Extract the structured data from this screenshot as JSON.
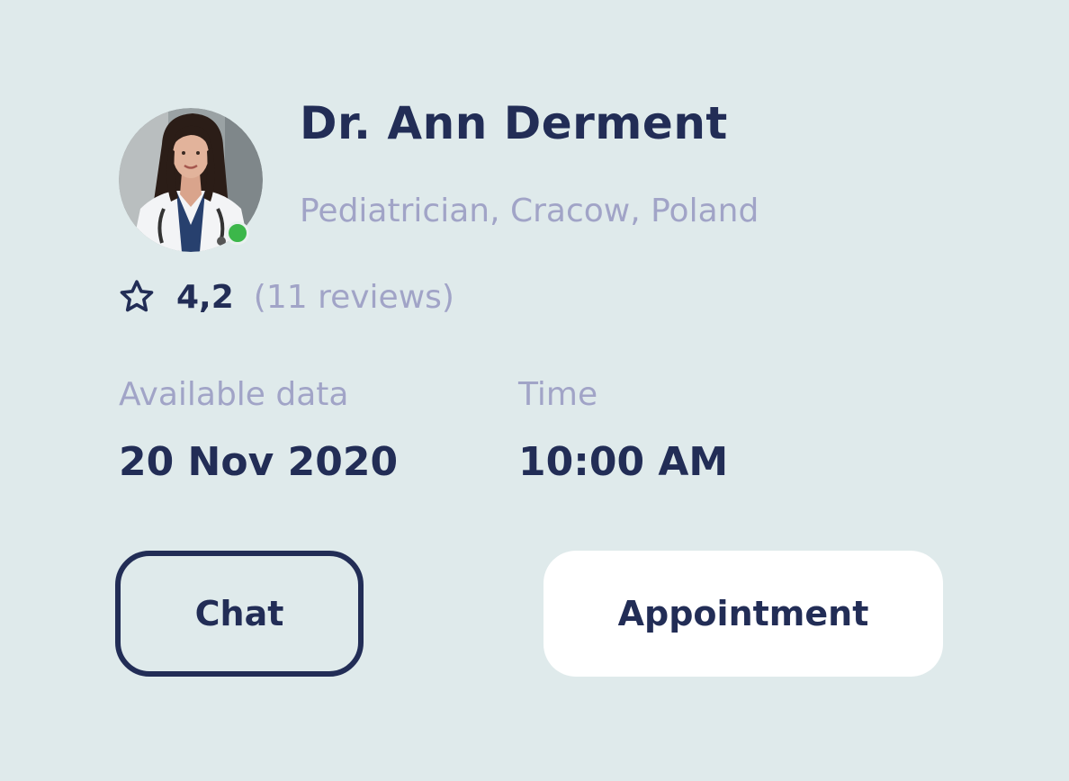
{
  "doctor": {
    "name": "Dr. Ann Derment",
    "specialty": "Pediatrician, Cracow, Poland",
    "online": true,
    "avatar_icon": "doctor-portrait"
  },
  "rating": {
    "icon": "star-outline-icon",
    "value": "4,2",
    "reviews": "(11 reviews)"
  },
  "availability": {
    "date_label": "Available data",
    "date_value": "20 Nov 2020",
    "time_label": "Time",
    "time_value": "10:00 AM"
  },
  "actions": {
    "chat_label": "Chat",
    "appointment_label": "Appointment"
  },
  "colors": {
    "background": "#dfeaeb",
    "primary_text": "#222d56",
    "secondary_text": "#a1a4c7",
    "online": "#3cb74a",
    "button_fill": "#ffffff"
  }
}
